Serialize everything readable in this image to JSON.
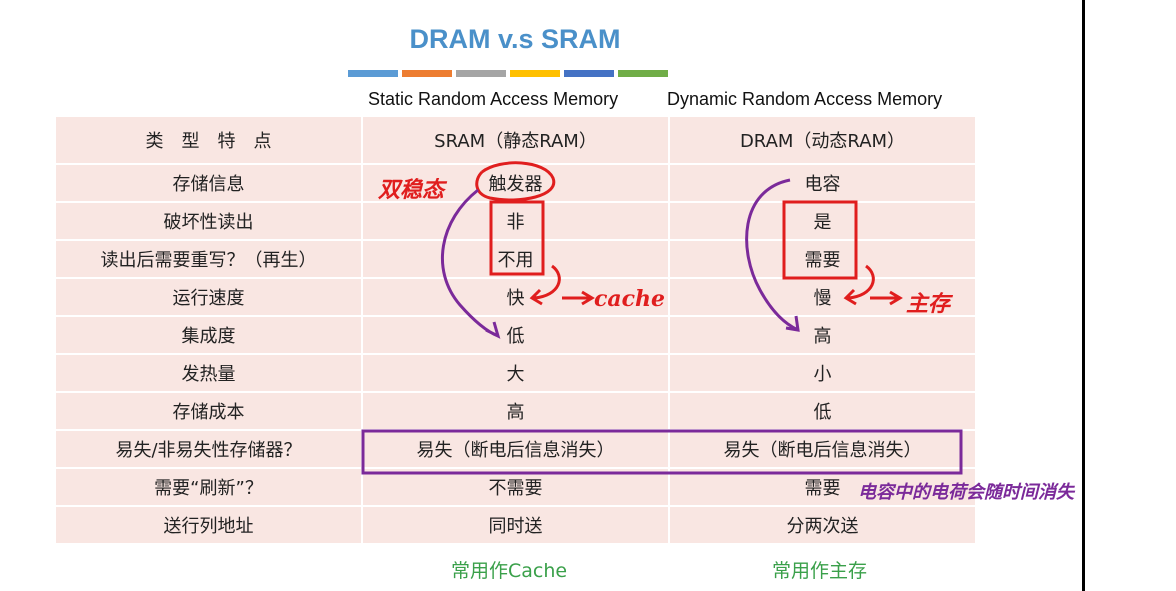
{
  "title": "DRAM v.s SRAM",
  "accent_bars": [
    "#5b9bd5",
    "#ed7d31",
    "#a5a5a5",
    "#ffc000",
    "#4472c4",
    "#70ad47"
  ],
  "columns": {
    "sram_full": "Static Random Access Memory",
    "dram_full": "Dynamic Random Access Memory"
  },
  "table": {
    "header": [
      "类　型　特　点",
      "SRAM（静态RAM）",
      "DRAM（动态RAM）"
    ],
    "rows": [
      [
        "存储信息",
        "触发器",
        "电容"
      ],
      [
        "破坏性读出",
        "非",
        "是"
      ],
      [
        "读出后需要重写？（再生）",
        "不用",
        "需要"
      ],
      [
        "运行速度",
        "快",
        "慢"
      ],
      [
        "集成度",
        "低",
        "高"
      ],
      [
        "发热量",
        "大",
        "小"
      ],
      [
        "存储成本",
        "高",
        "低"
      ],
      [
        "易失/非易失性存储器？",
        "易失（断电后信息消失）",
        "易失（断电后信息消失）"
      ],
      [
        "需要“刷新”？",
        "不需要",
        "需要"
      ],
      [
        "送行列地址",
        "同时送",
        "分两次送"
      ]
    ]
  },
  "footer": {
    "sram_use": "常用作Cache",
    "dram_use": "常用作主存"
  },
  "annotations": {
    "sram_storage": "双稳态",
    "sram_speed": "cache",
    "dram_speed": "主存",
    "dram_refresh": "电容中的电荷会随时间消失"
  },
  "colors": {
    "title": "#4a90c9",
    "table_bg": "#f9e6e2",
    "footer": "#3aa04a",
    "ink_red": "#e01e1e",
    "ink_purple": "#7b2a9a"
  }
}
